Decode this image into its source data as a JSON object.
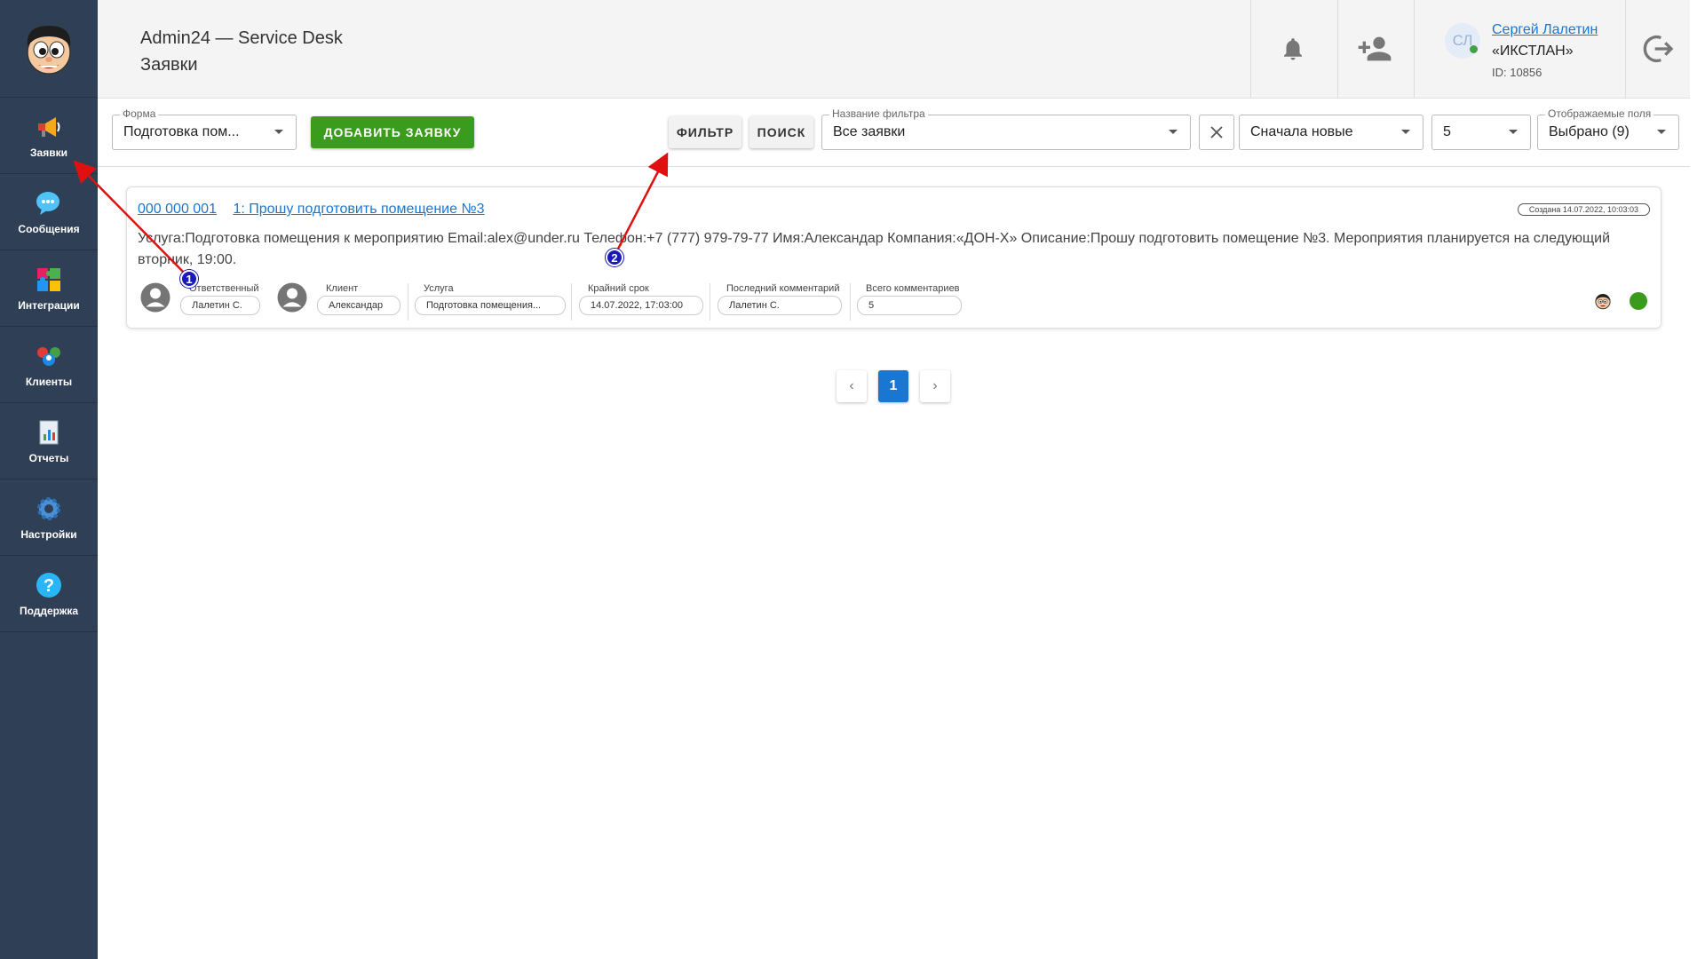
{
  "sidebar": {
    "items": [
      {
        "label": "Заявки",
        "icon": "megaphone-icon"
      },
      {
        "label": "Сообщения",
        "icon": "chat-icon"
      },
      {
        "label": "Интеграции",
        "icon": "puzzle-icon"
      },
      {
        "label": "Клиенты",
        "icon": "clients-icon"
      },
      {
        "label": "Отчеты",
        "icon": "report-icon"
      },
      {
        "label": "Настройки",
        "icon": "gear-icon"
      },
      {
        "label": "Поддержка",
        "icon": "help-icon"
      }
    ]
  },
  "header": {
    "app_title": "Admin24 — Service Desk",
    "page_title": "Заявки",
    "user": {
      "initials": "СЛ",
      "name": "Сергей Лалетин",
      "company": "«ИКСТЛАН»",
      "id": "ID: 10856"
    }
  },
  "toolbar": {
    "form_label": "Форма",
    "form_value": "Подготовка пом...",
    "add_button": "ДОБАВИТЬ ЗАЯВКУ",
    "filter_button": "ФИЛЬТР",
    "search_button": "ПОИСК",
    "filter_name_label": "Название фильтра",
    "filter_name_value": "Все заявки",
    "sort_value": "Сначала новые",
    "per_page_value": "5",
    "fields_label": "Отображаемые поля",
    "fields_value": "Выбрано (9)"
  },
  "ticket": {
    "number": "000 000 001",
    "title": "1: Прошу подготовить помещение №3",
    "created": "Создана 14.07.2022, 10:03:03",
    "description": "Услуга:Подготовка помещения к мероприятию Email:alex@under.ru Телефон:+7 (777) 979-79-77 Имя:Александар Компания:«ДОН-Х» Описание:Прошу подготовить помещение №3. Мероприятия планируется на следующий вторник, 19:00.",
    "meta": [
      {
        "label": "Ответственный",
        "value": "Лалетин С."
      },
      {
        "label": "Клиент",
        "value": "Александар"
      },
      {
        "label": "Услуга",
        "value": "Подготовка помещения..."
      },
      {
        "label": "Крайний срок",
        "value": "14.07.2022, 17:03:00"
      },
      {
        "label": "Последний комментарий",
        "value": "Лалетин С."
      },
      {
        "label": "Всего комментариев",
        "value": "5"
      }
    ],
    "status_color": "#3a9b1c"
  },
  "pagination": {
    "current": "1",
    "prev": "‹",
    "next": "›"
  },
  "annotations": {
    "marker1": "1",
    "marker2": "2",
    "arrow_color": "#e01010"
  }
}
